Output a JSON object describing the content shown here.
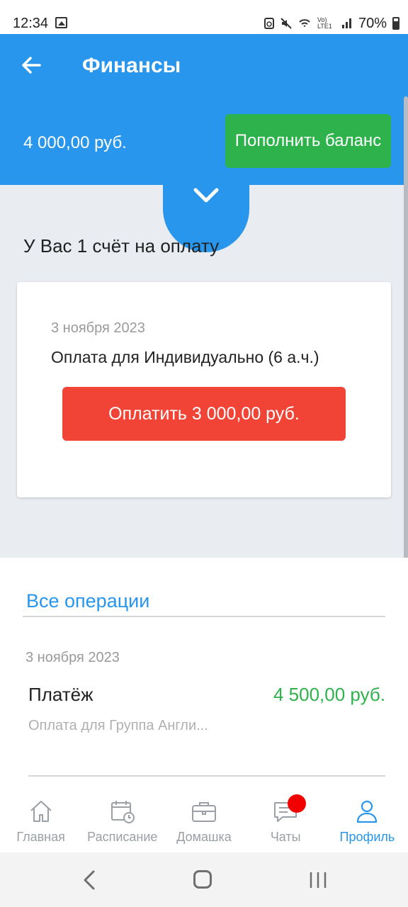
{
  "status_bar": {
    "time": "12:34",
    "network": "Vo) LTE1",
    "battery": "70%"
  },
  "header": {
    "title": "Финансы",
    "balance": "4 000,00 руб.",
    "topup_label": "Пополнить баланс"
  },
  "bills": {
    "heading": "У Вас 1 счёт на оплату",
    "items": [
      {
        "date": "3 ноября 2023",
        "description": "Оплата для Индивидуально (6 а.ч.)",
        "pay_label": "Оплатить 3 000,00 руб."
      }
    ]
  },
  "operations": {
    "title": "Все операции",
    "items": [
      {
        "date": "3 ноября 2023",
        "type": "Платёж",
        "amount": "4 500,00 руб.",
        "description": "Оплата для Группа Англи..."
      }
    ]
  },
  "bottom_nav": {
    "items": [
      {
        "label": "Главная",
        "icon": "home-icon",
        "active": false
      },
      {
        "label": "Расписание",
        "icon": "calendar-icon",
        "active": false
      },
      {
        "label": "Домашка",
        "icon": "briefcase-icon",
        "active": false
      },
      {
        "label": "Чаты",
        "icon": "chat-icon",
        "active": false,
        "badge": true
      },
      {
        "label": "Профиль",
        "icon": "profile-icon",
        "active": true
      }
    ]
  },
  "colors": {
    "primary": "#2896ec",
    "success": "#2eb34c",
    "danger": "#f24436",
    "badge": "#f20000"
  }
}
